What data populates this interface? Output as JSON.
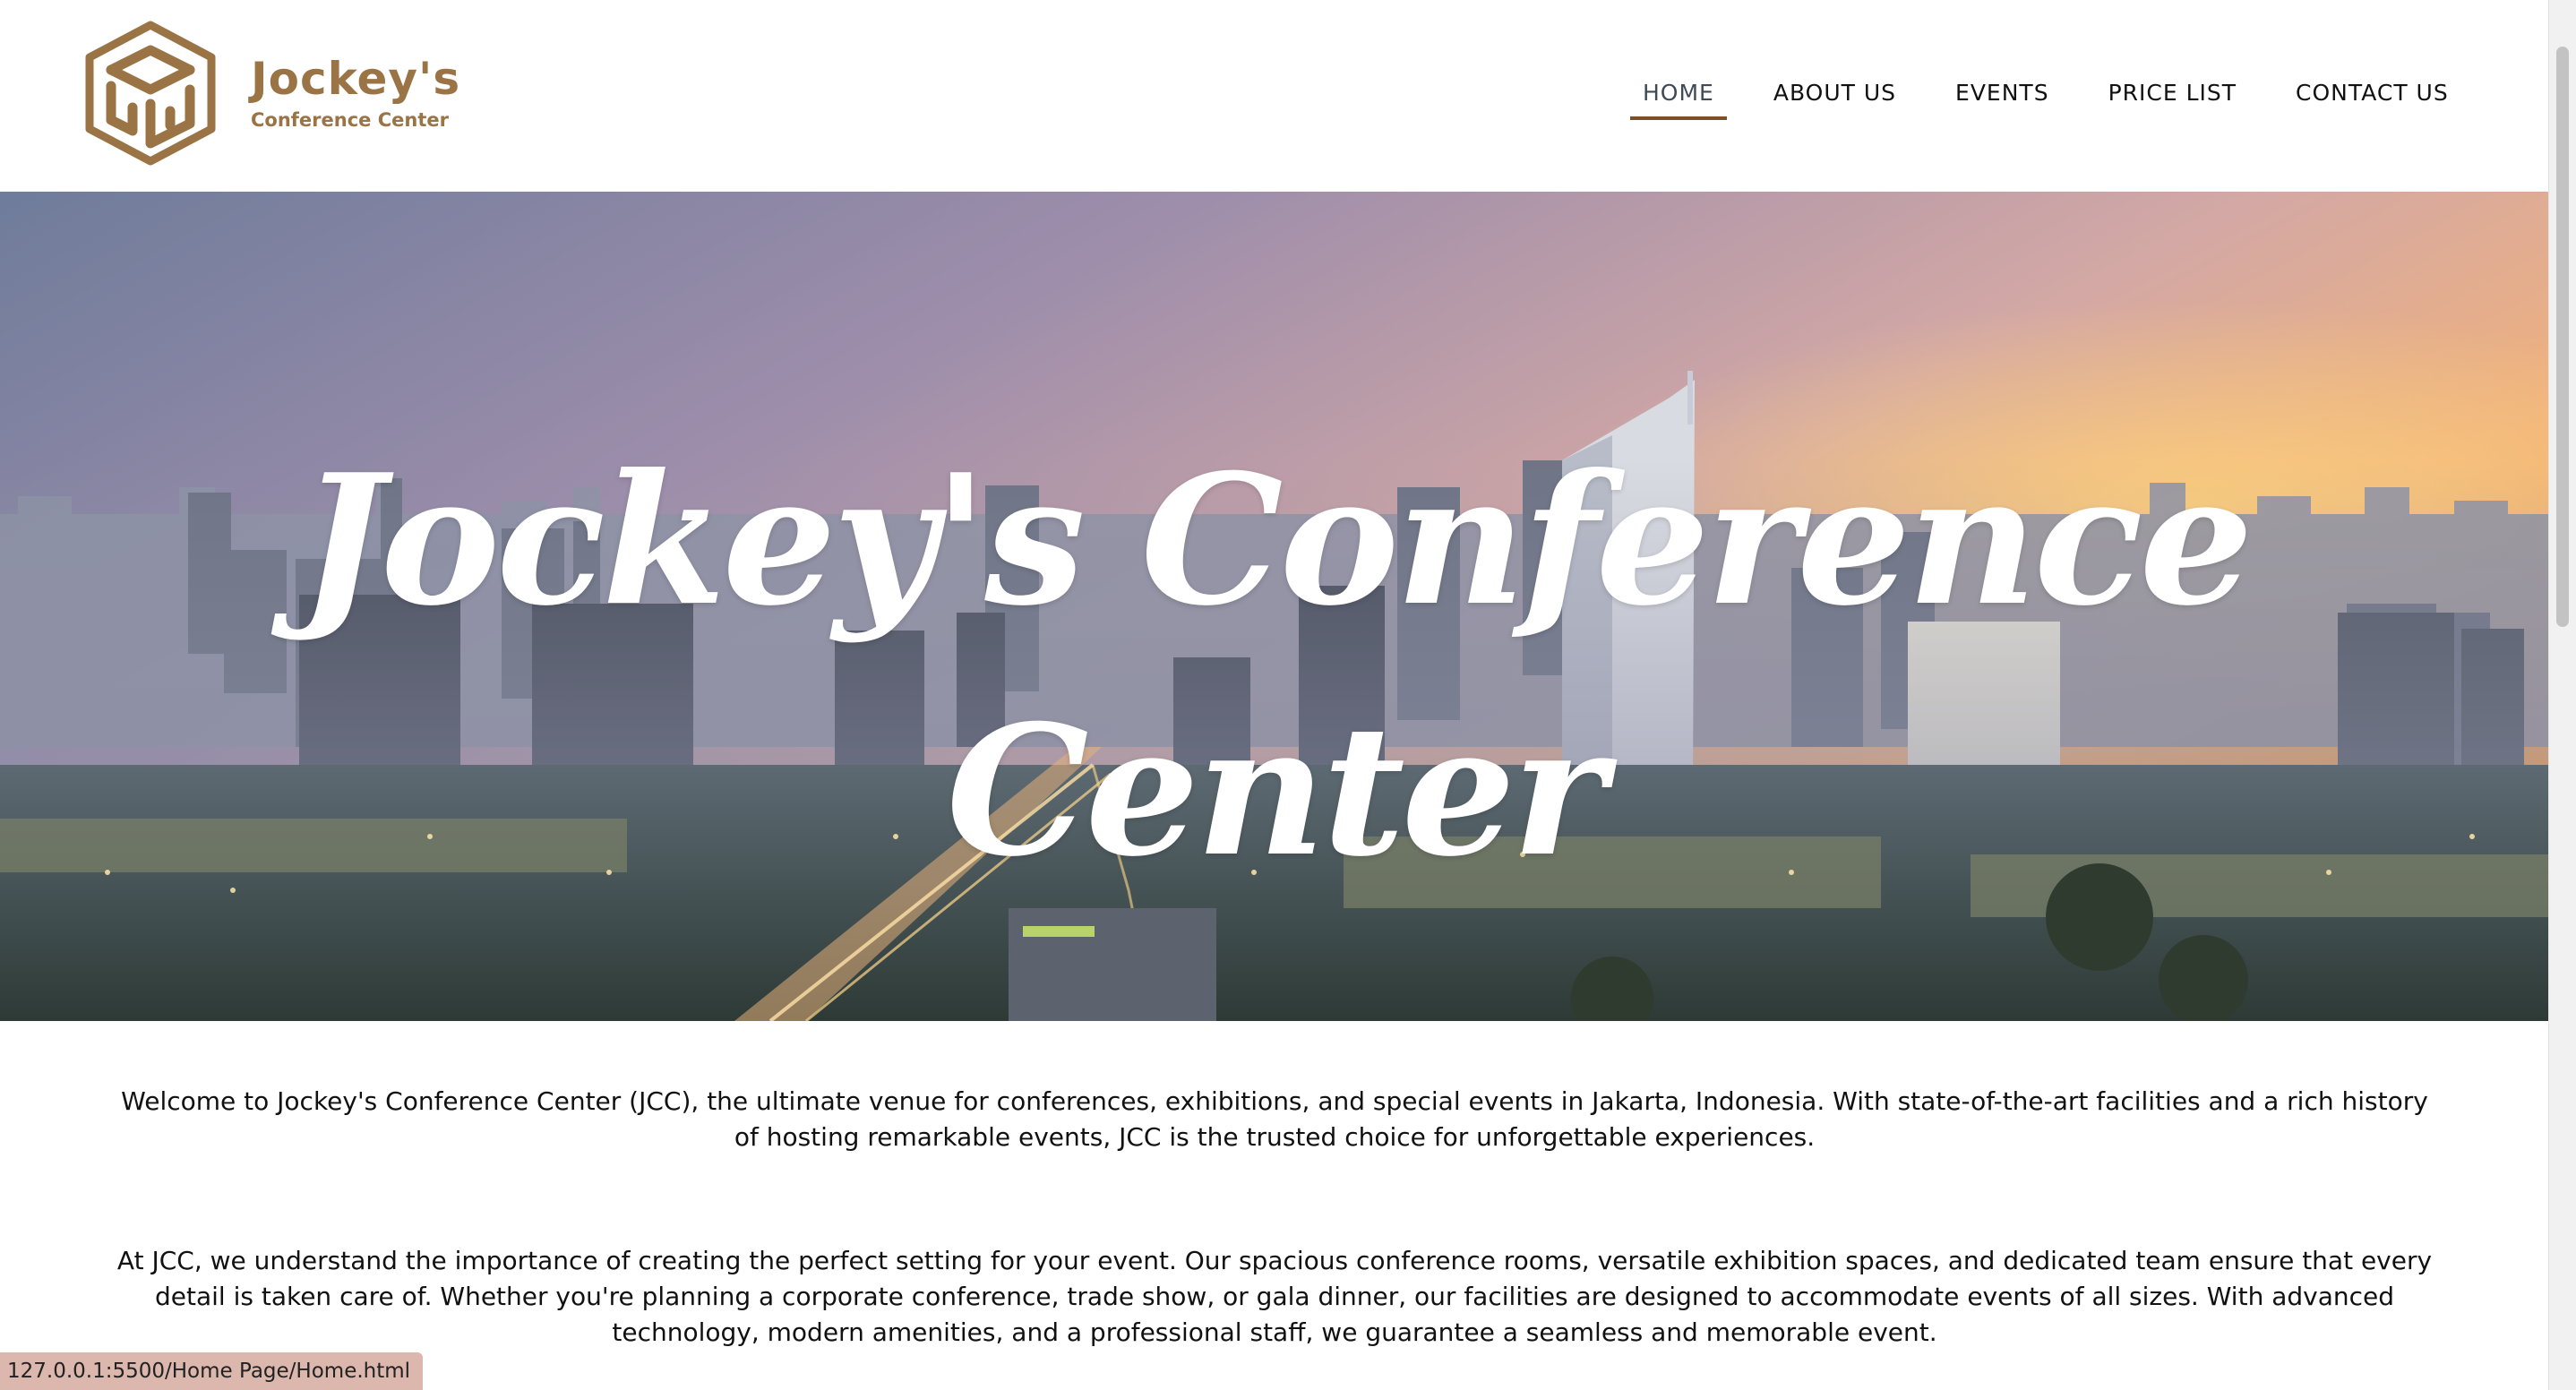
{
  "header": {
    "logo_title": "Jockey's",
    "logo_subtitle": "Conference Center"
  },
  "nav": {
    "items": [
      {
        "label": "HOME",
        "active": true
      },
      {
        "label": "ABOUT US",
        "active": false
      },
      {
        "label": "EVENTS",
        "active": false
      },
      {
        "label": "PRICE LIST",
        "active": false
      },
      {
        "label": "CONTACT US",
        "active": false
      }
    ]
  },
  "hero": {
    "title_line1": "Jockey's Conference",
    "title_line2": "Center"
  },
  "content": {
    "paragraphs": [
      "Welcome to Jockey's Conference Center (JCC), the ultimate venue for conferences, exhibitions, and special events in Jakarta, Indonesia. With state-of-the-art facilities and a rich history of hosting remarkable events, JCC is the trusted choice for unforgettable experiences.",
      "At JCC, we understand the importance of creating the perfect setting for your event. Our spacious conference rooms, versatile exhibition spaces, and dedicated team ensure that every detail is taken care of. Whether you're planning a corporate conference, trade show, or gala dinner, our facilities are designed to accommodate events of all sizes. With advanced technology, modern amenities, and a professional staff, we guarantee a seamless and memorable event."
    ]
  },
  "status_bar": {
    "url": "127.0.0.1:5500/Home Page/Home.html"
  },
  "colors": {
    "brand": "#9b7446",
    "nav_active_underline": "#7a4f2a",
    "text": "#111111"
  },
  "icons": {
    "logo": "cube-j-logo-icon"
  }
}
